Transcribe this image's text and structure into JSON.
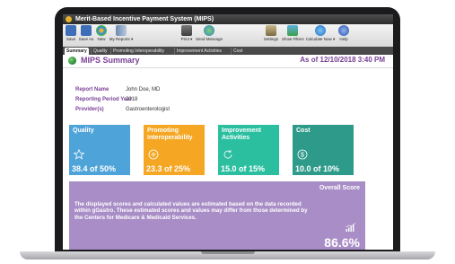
{
  "window": {
    "title": "Merit-Based Incentive Payment System (MIPS)"
  },
  "toolbar": {
    "items": [
      {
        "label": "Save",
        "icon": "save-icon"
      },
      {
        "label": "Save As",
        "icon": "save-as-icon"
      },
      {
        "label": "New",
        "icon": "new-icon"
      },
      {
        "label": "My Reports ▾",
        "icon": "my-reports-icon"
      },
      {
        "label": "Print ▾",
        "icon": "print-icon"
      },
      {
        "label": "Send Message",
        "icon": "send-message-icon"
      },
      {
        "label": "Settings",
        "icon": "settings-icon"
      },
      {
        "label": "Show Filters",
        "icon": "filter-icon"
      },
      {
        "label": "Calculate Now ▾",
        "icon": "calculate-icon"
      },
      {
        "label": "Help",
        "icon": "help-icon"
      }
    ]
  },
  "tabs": [
    {
      "label": "Summary",
      "active": true
    },
    {
      "label": "Quality"
    },
    {
      "label": "Promoting Interoperability"
    },
    {
      "label": "Improvement Activities"
    },
    {
      "label": "Cost"
    }
  ],
  "summary": {
    "title": "MIPS Summary",
    "as_of": "As of 12/10/2018 3:40 PM",
    "report_name_label": "Report Name",
    "report_name": "John Doe, MD",
    "period_label": "Reporting Period Year",
    "period": "2018",
    "provider_label": "Provider(s)",
    "provider": "Gastroenterologist"
  },
  "tiles": [
    {
      "name": "Quality",
      "score": "38.4 of 50%",
      "color": "#4ea3d8",
      "icon": "star-icon"
    },
    {
      "name": "Promoting Interoperability",
      "score": "23.3 of 25%",
      "color": "#f5a623",
      "icon": "plus-circle-icon"
    },
    {
      "name": "Improvement Activities",
      "score": "15.0 of 15%",
      "color": "#2bbfa0",
      "icon": "refresh-icon"
    },
    {
      "name": "Cost",
      "score": "10.0 of 10%",
      "color": "#2e9b8a",
      "icon": "dollar-circle-icon"
    }
  ],
  "overall": {
    "title": "Overall Score",
    "disclaimer": "The displayed scores and calculated values are estimated based on the data recorded within gGastro. These estimated scores and values may differ from those determined by the Centers for Medicare & Medicaid Services.",
    "score": "86.6%",
    "color": "#a98dc6"
  }
}
